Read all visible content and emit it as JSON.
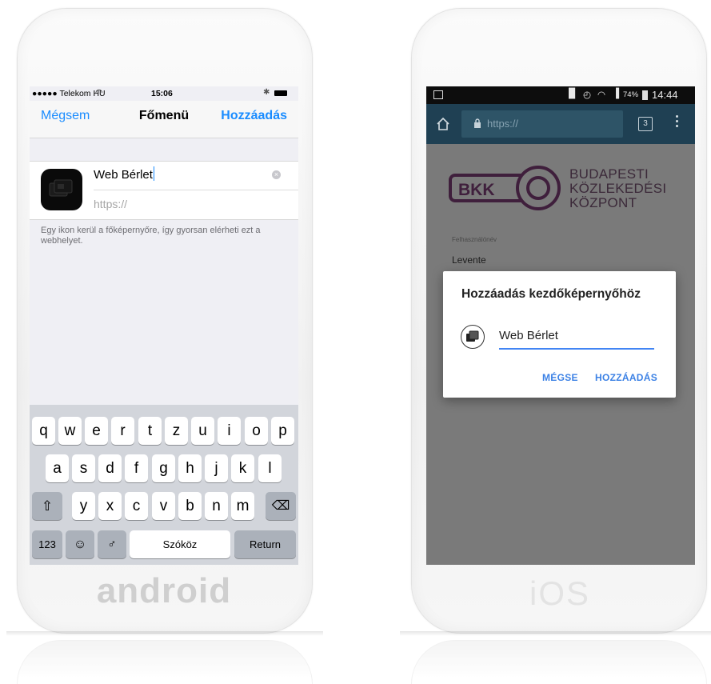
{
  "left_phone": {
    "brand_label": "android",
    "status": {
      "carrier": "●●●●● Telekom HU",
      "wifi_icon": "wifi-icon",
      "time": "15:06",
      "bluetooth_icon": "bluetooth-icon",
      "battery_icon": "battery-icon"
    },
    "nav": {
      "cancel": "Mégsem",
      "title": "Főmenü",
      "add": "Hozzáadás"
    },
    "bookmark": {
      "name": "Web Bérlet",
      "url_placeholder": "https://",
      "clear_icon": "clear-icon"
    },
    "help_text": "Egy ikon kerül a főképernyőre, így gyorsan elérheti ezt a webhelyet.",
    "keyboard": {
      "row1": [
        "q",
        "w",
        "e",
        "r",
        "t",
        "z",
        "u",
        "i",
        "o",
        "p"
      ],
      "row2": [
        "a",
        "s",
        "d",
        "f",
        "g",
        "h",
        "j",
        "k",
        "l"
      ],
      "row3": [
        "y",
        "x",
        "c",
        "v",
        "b",
        "n",
        "m"
      ],
      "shift_icon": "shift-icon",
      "delete_icon": "backspace-icon",
      "numbers": "123",
      "emoji_icon": "emoji-icon",
      "mic_icon": "microphone-icon",
      "space": "Szóköz",
      "return": "Return"
    }
  },
  "right_phone": {
    "brand_label": "iOS",
    "status": {
      "battery_percent": "74%",
      "time": "14:44",
      "signal_icon": "signal-icon"
    },
    "toolbar": {
      "url": "https://",
      "tab_count": "3",
      "home_icon": "home-icon",
      "lock_icon": "lock-icon",
      "menu_icon": "overflow-menu-icon"
    },
    "page": {
      "logo_text": "BKK",
      "org_lines": [
        "BUDAPESTI",
        "KÖZLEKEDÉSI",
        "KÖZPONT"
      ],
      "username_label": "Felhasználónév",
      "username_value": "Levente"
    },
    "dialog": {
      "title": "Hozzáadás kezdőképernyőhöz",
      "input_value": "Web Bérlet",
      "cancel": "MÉGSE",
      "add": "HOZZÁADÁS"
    }
  }
}
